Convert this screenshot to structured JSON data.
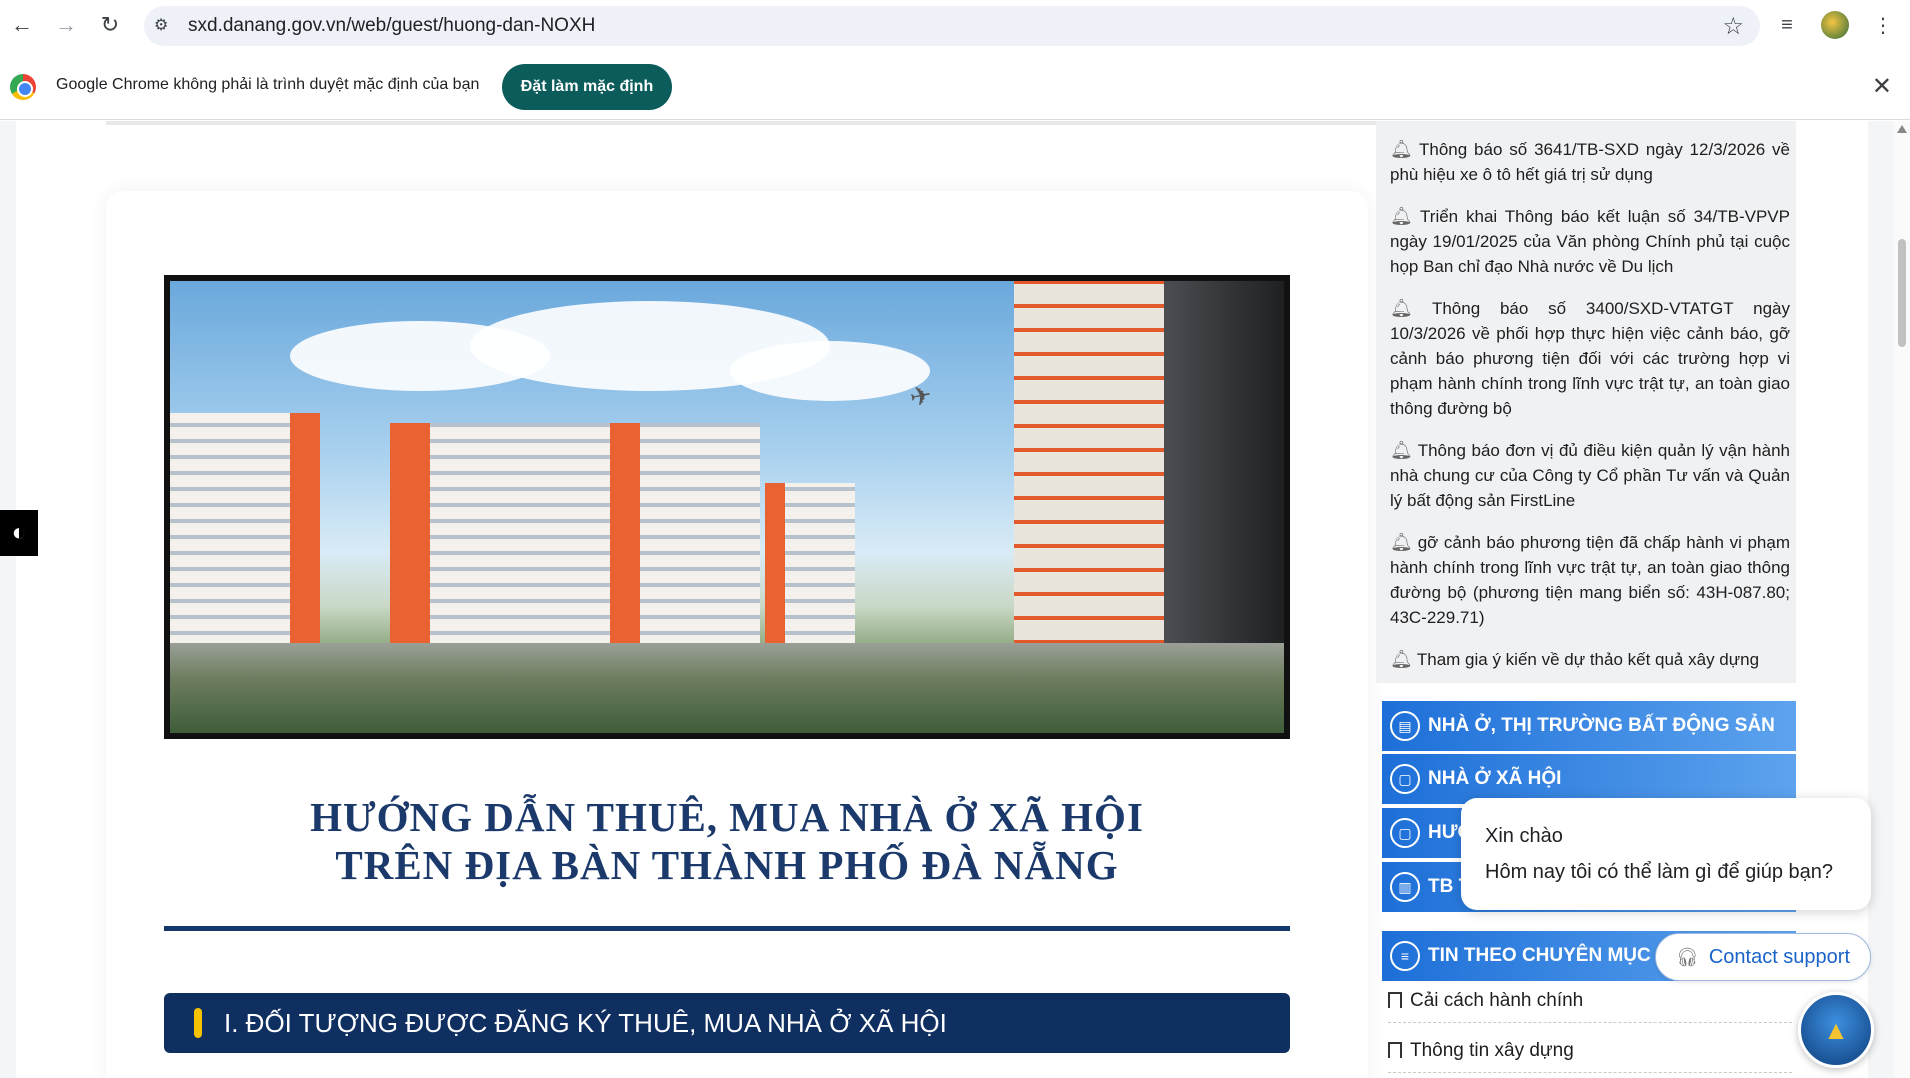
{
  "browser": {
    "url": "sxd.danang.gov.vn/web/guest/huong-dan-NOXH",
    "infobar_text": "Google Chrome không phải là trình duyệt mặc định của bạn",
    "default_button": "Đặt làm mặc định",
    "close_glyph": "✕",
    "back_glyph": "←",
    "forward_glyph": "→",
    "reload_glyph": "↻",
    "star_glyph": "☆",
    "menu_glyph": "⋮"
  },
  "main": {
    "title_line1": "HƯỚNG DẪN THUÊ, MUA NHÀ Ở XÃ HỘI",
    "title_line2": "TRÊN ĐỊA BÀN THÀNH PHỐ ĐÀ NẴNG",
    "section1": "I. ĐỐI TƯỢNG ĐƯỢC ĐĂNG KÝ THUÊ, MUA NHÀ Ở XÃ HỘI"
  },
  "notices": [
    "Thông báo số 3641/TB-SXD ngày 12/3/2026 về phù hiệu xe ô tô hết giá trị sử dụng",
    "Triển khai Thông báo kết luận số 34/TB-VPVP ngày 19/01/2025 của Văn phòng Chính phủ tại cuộc họp Ban chỉ đạo Nhà nước về Du lịch",
    "Thông báo số 3400/SXD-VTATGT ngày 10/3/2026 về phối hợp thực hiện việc cảnh báo, gỡ cảnh báo phương tiện đối với các trường hợp vi phạm hành chính trong lĩnh vực trật tự, an toàn giao thông đường bộ",
    "Thông báo đơn vị đủ điều kiện quản lý vận hành nhà chung cư của Công ty Cổ phần Tư vấn và Quản lý bất động sản FirstLine",
    "gỡ cảnh báo phương tiện đã chấp hành vi phạm hành chính trong lĩnh vực trật tự, an toàn giao thông đường bộ (phương tiện mang biển số: 43H-087.80; 43C-229.71)",
    "Tham gia ý kiến về dự thảo kết quả xây dựng"
  ],
  "menu": [
    "NHÀ Ở, THỊ TRƯỜNG BẤT ĐỘNG SẢN",
    "NHÀ Ở XÃ HỘI",
    "HƯỚ",
    "TB T"
  ],
  "category_header": "TIN THEO CHUYÊN MỤC",
  "categories": [
    "Cải cách hành chính",
    "Thông tin xây dựng"
  ],
  "chat": {
    "greeting": "Xin chào",
    "question": "Hôm nay tôi có thể làm gì để giúp bạn?",
    "contact": "Contact support"
  }
}
